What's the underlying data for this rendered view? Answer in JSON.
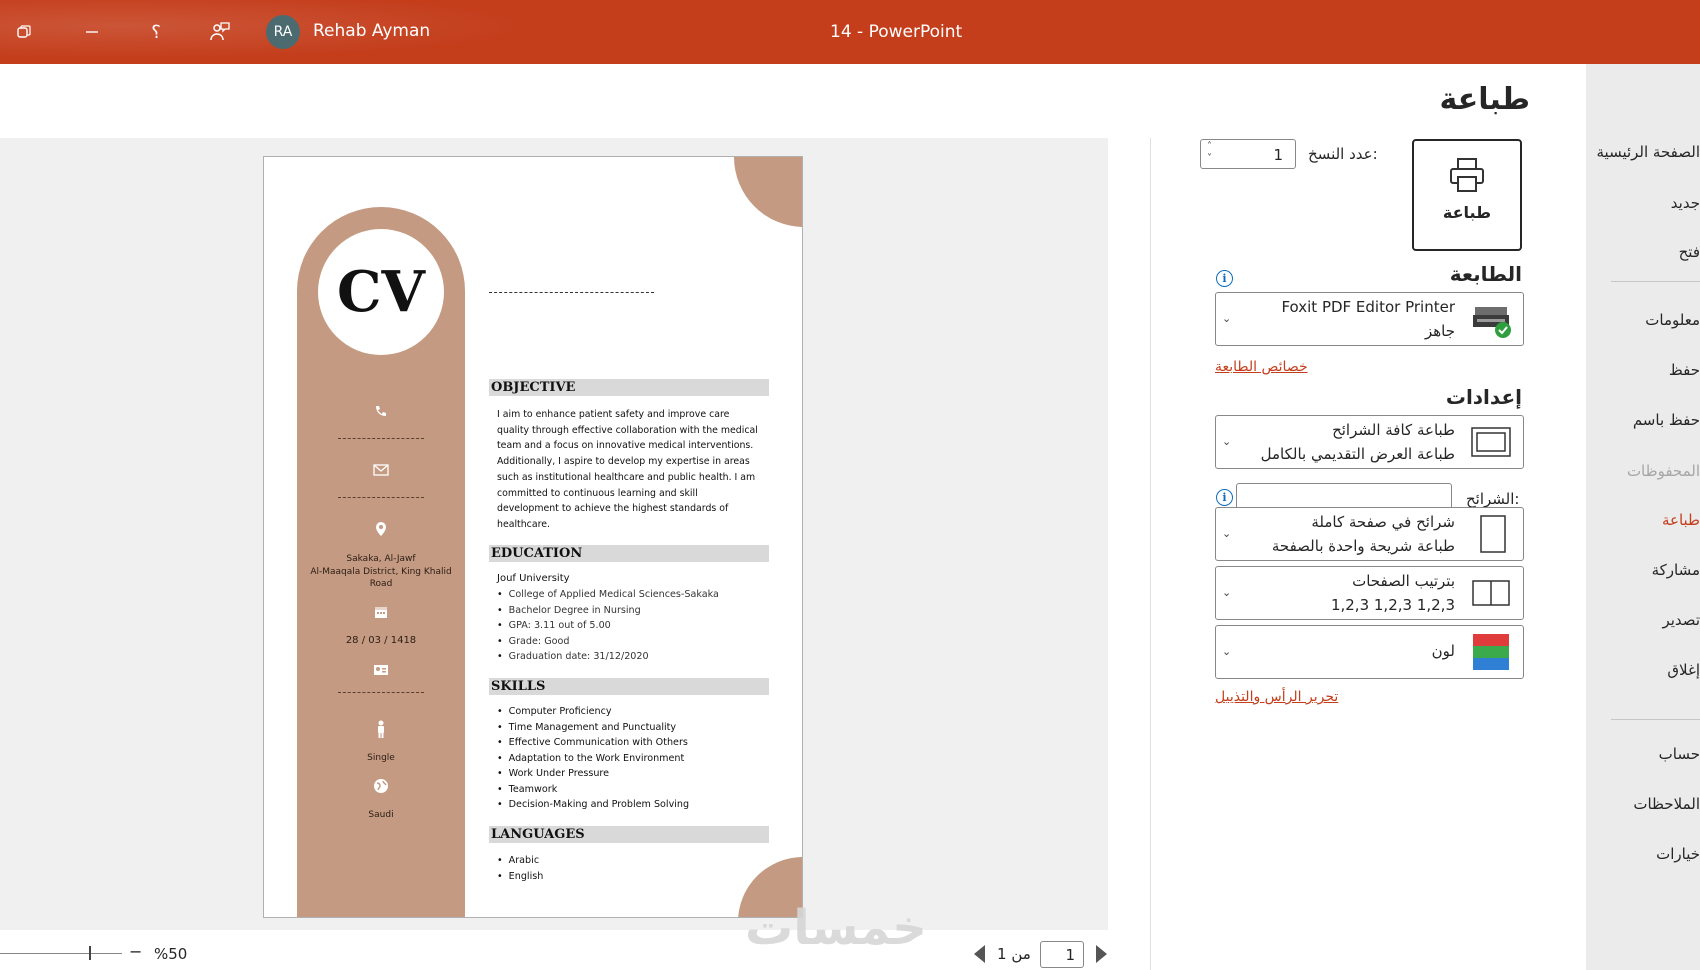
{
  "titlebar": {
    "user_name": "Rehab Ayman",
    "user_initials": "RA",
    "doc_title": "14  -  PowerPoint",
    "help_glyph": "؟",
    "icons": [
      "restore-icon",
      "minimize-icon",
      "help-icon",
      "feedback-icon"
    ]
  },
  "nav": {
    "items": [
      "الصفحة الرئيسية",
      "جديد",
      "فتح",
      "معلومات",
      "حفظ",
      "حفظ باسم",
      "المحفوظات",
      "طباعة",
      "مشاركة",
      "تصدير",
      "إغلاق",
      "حساب",
      "الملاحظات",
      "خيارات"
    ]
  },
  "print": {
    "heading": "طباعة",
    "print_button": "طباعة",
    "copies_label": "عدد النسخ:",
    "copies_value": "1",
    "printer_section": "الطابعة",
    "printer_name": "Foxit PDF Editor Printer",
    "printer_status": "جاهز",
    "printer_props_link": "خصائص الطابعة",
    "settings_section": "إعدادات",
    "slides_setting_title": "طباعة كافة الشرائح",
    "slides_setting_sub": "طباعة العرض التقديمي بالكامل",
    "slides_label": "الشرائح:",
    "slides_value": "",
    "layout_title": "شرائح في صفحة كاملة",
    "layout_sub": "طباعة شريحة واحدة بالصفحة",
    "collate_title": "بترتيب الصفحات",
    "collate_sub": "1,2,3    1,2,3    1,2,3",
    "color_title": "لون",
    "header_footer_link": "تحرير الرأس والتذييل",
    "status_color": "#c43e1c"
  },
  "preview": {
    "cv_logo": "CV",
    "name_line": "",
    "sidebar": {
      "address_line1": "Sakaka, Al-Jawf",
      "address_line2": "Al-Maaqala District, King Khalid Road",
      "birth_date": "28 / 03 / 1418",
      "marital": "Single",
      "nationality": "Saudi"
    },
    "objective_heading": "OBJECTIVE",
    "objective_text": "I aim to enhance patient safety and improve care quality through effective collaboration with the medical team and a focus on innovative medical interventions. Additionally, I aspire to develop my expertise in areas such as institutional healthcare and public health. I am committed to continuous learning and skill development to achieve the highest standards of healthcare.",
    "education_heading": "EDUCATION",
    "university": "Jouf University",
    "education_items": [
      "College of Applied Medical Sciences-Sakaka",
      "Bachelor Degree in Nursing",
      "GPA: 3.11 out of 5.00",
      "Grade: Good",
      "Graduation date: 31/12/2020"
    ],
    "skills_heading": "SKILLS",
    "skills_items": [
      "Computer Proficiency",
      "Time Management and Punctuality",
      "Effective Communication with Others",
      "Adaptation to the Work Environment",
      "Work Under Pressure",
      "Teamwork",
      "Decision-Making and Problem Solving"
    ],
    "languages_heading": "LANGUAGES",
    "languages_items": [
      "Arabic",
      "English"
    ],
    "accent_color": "#c49a82"
  },
  "statusbar": {
    "zoom": "%50",
    "zoom_minus": "−",
    "page_current": "1",
    "page_of": "من 1",
    "watermark": "خمسات"
  }
}
